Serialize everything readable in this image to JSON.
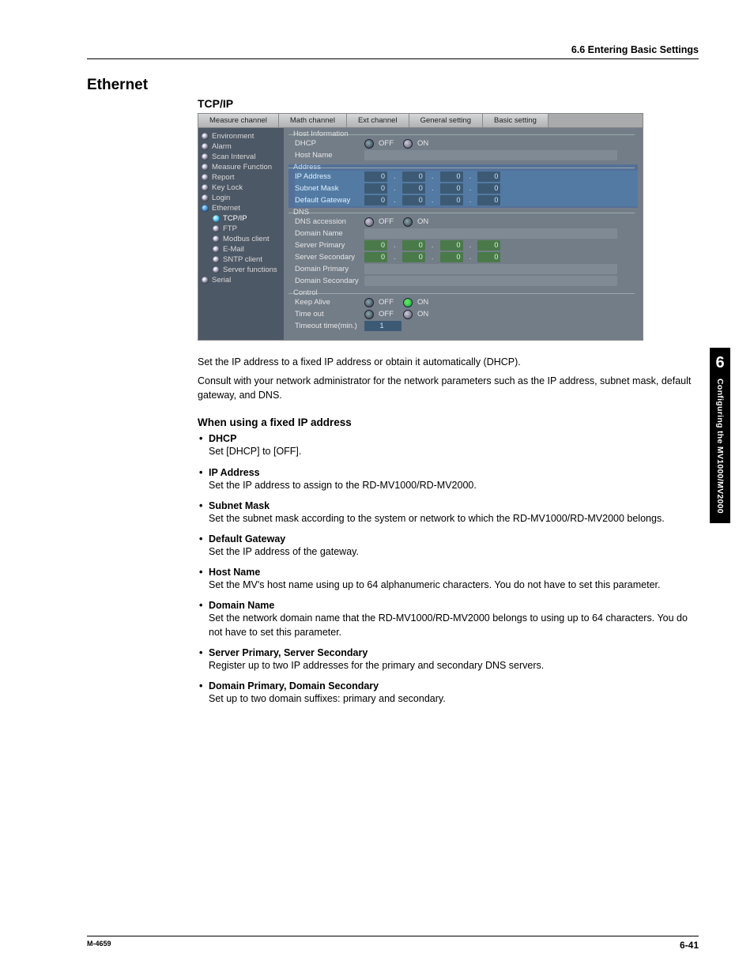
{
  "header": {
    "breadcrumb": "6.6  Entering Basic Settings"
  },
  "section_title": "Ethernet",
  "sub_title": "TCP/IP",
  "screenshot": {
    "tabs": [
      "Measure channel",
      "Math channel",
      "Ext channel",
      "General setting",
      "Basic setting"
    ],
    "tree": [
      {
        "label": "Environment",
        "sub": false,
        "state": "closed"
      },
      {
        "label": "Alarm",
        "sub": false,
        "state": "closed"
      },
      {
        "label": "Scan Interval",
        "sub": false,
        "state": "closed"
      },
      {
        "label": "Measure Function",
        "sub": false,
        "state": "closed"
      },
      {
        "label": "Report",
        "sub": false,
        "state": "closed"
      },
      {
        "label": "Key Lock",
        "sub": false,
        "state": "closed"
      },
      {
        "label": "Login",
        "sub": false,
        "state": "closed"
      },
      {
        "label": "Ethernet",
        "sub": false,
        "state": "open"
      },
      {
        "label": "TCP/IP",
        "sub": true,
        "state": "selected"
      },
      {
        "label": "FTP",
        "sub": true,
        "state": "closed"
      },
      {
        "label": "Modbus client",
        "sub": true,
        "state": "closed"
      },
      {
        "label": "E-Mail",
        "sub": true,
        "state": "closed"
      },
      {
        "label": "SNTP client",
        "sub": true,
        "state": "closed"
      },
      {
        "label": "Server functions",
        "sub": true,
        "state": "closed"
      },
      {
        "label": "Serial",
        "sub": false,
        "state": "closed"
      }
    ],
    "groups": {
      "host_info": {
        "legend": "Host Information",
        "dhcp_label": "DHCP",
        "dhcp_off": "OFF",
        "dhcp_on": "ON",
        "host_name_label": "Host Name"
      },
      "address": {
        "legend": "Address",
        "ip_label": "IP Address",
        "ip": [
          "0",
          "0",
          "0",
          "0"
        ],
        "mask_label": "Subnet Mask",
        "mask": [
          "0",
          "0",
          "0",
          "0"
        ],
        "gw_label": "Default Gateway",
        "gw": [
          "0",
          "0",
          "0",
          "0"
        ]
      },
      "dns": {
        "legend": "DNS",
        "acc_label": "DNS accession",
        "acc_off": "OFF",
        "acc_on": "ON",
        "domain_label": "Domain Name",
        "sp_label": "Server Primary",
        "sp": [
          "0",
          "0",
          "0",
          "0"
        ],
        "ss_label": "Server Secondary",
        "ss": [
          "0",
          "0",
          "0",
          "0"
        ],
        "dp_label": "Domain Primary",
        "ds_label": "Domain Secondary"
      },
      "control": {
        "legend": "Control",
        "ka_label": "Keep Alive",
        "ka_off": "OFF",
        "ka_on": "ON",
        "to_label": "Time out",
        "to_off": "OFF",
        "to_on": "ON",
        "totime_label": "Timeout time(min.)",
        "totime_val": "1"
      }
    }
  },
  "intro": [
    "Set the IP address to a fixed IP address or obtain it automatically (DHCP).",
    "Consult with your network administrator for the network parameters such as the IP address, subnet mask, default gateway, and DNS."
  ],
  "fixed_ip_heading": "When using a fixed IP address",
  "bullets": [
    {
      "head": "DHCP",
      "body": "Set [DHCP] to [OFF]."
    },
    {
      "head": "IP Address",
      "body": "Set the IP address to assign to the RD-MV1000/RD-MV2000."
    },
    {
      "head": "Subnet Mask",
      "body": "Set the subnet mask according to the system or network to which the RD-MV1000/RD-MV2000 belongs."
    },
    {
      "head": "Default Gateway",
      "body": "Set the IP address of the gateway."
    },
    {
      "head": "Host Name",
      "body": "Set the MV's host name using up to 64 alphanumeric characters.  You do not have to set this parameter."
    },
    {
      "head": "Domain Name",
      "body": "Set the network domain name that the RD-MV1000/RD-MV2000 belongs to using up to 64 characters.  You do not have to set this parameter."
    },
    {
      "head": "Server Primary, Server Secondary",
      "body": "Register up to two IP addresses for the primary and secondary DNS servers."
    },
    {
      "head": "Domain Primary, Domain Secondary",
      "body": "Set up to two domain suffixes: primary and secondary."
    }
  ],
  "side_tab": {
    "chapter": "6",
    "title": "Configuring the MV1000/MV2000"
  },
  "footer": {
    "left": "M-4659",
    "right": "6-41"
  }
}
